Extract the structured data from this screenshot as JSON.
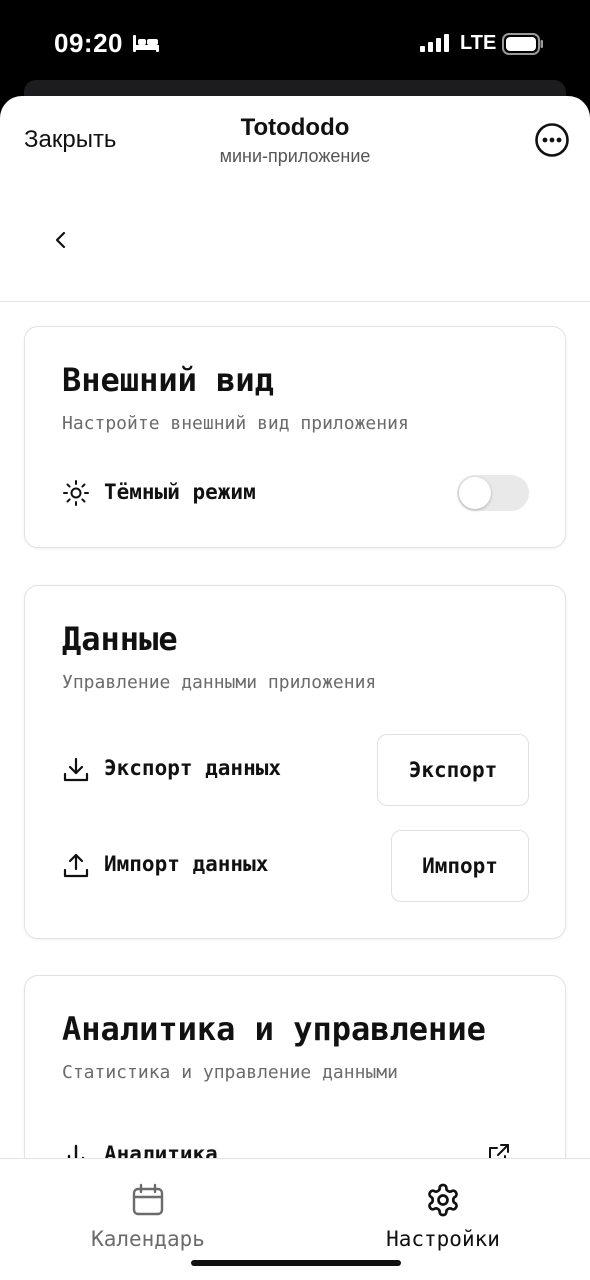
{
  "status_bar": {
    "time": "09:20",
    "network": "LTE",
    "icons": [
      "bed-icon",
      "signal-icon",
      "battery-icon"
    ]
  },
  "header": {
    "close_label": "Закрыть",
    "title": "Totododo",
    "subtitle": "мини-приложение",
    "more_icon": "ellipsis-circle-icon",
    "back_icon": "chevron-left-icon"
  },
  "appearance": {
    "title": "Внешний вид",
    "subtitle": "Настройте внешний вид приложения",
    "dark_mode_label": "Тёмный режим",
    "dark_mode_icon": "sun-icon",
    "dark_mode_enabled": false
  },
  "data_section": {
    "title": "Данные",
    "subtitle": "Управление данными приложения",
    "export_label": "Экспорт данных",
    "export_button": "Экспорт",
    "import_label": "Импорт данных",
    "import_button": "Импорт"
  },
  "analytics": {
    "title": "Аналитика и управление",
    "subtitle": "Статистика и управление данными",
    "analytics_label": "Аналитика"
  },
  "tabbar": {
    "calendar_label": "Календарь",
    "settings_label": "Настройки",
    "active_tab": "settings"
  },
  "colors": {
    "accent": "#111111",
    "inactive_tab": "#6b6b6b",
    "toggle_off": "#e9e9ea"
  }
}
